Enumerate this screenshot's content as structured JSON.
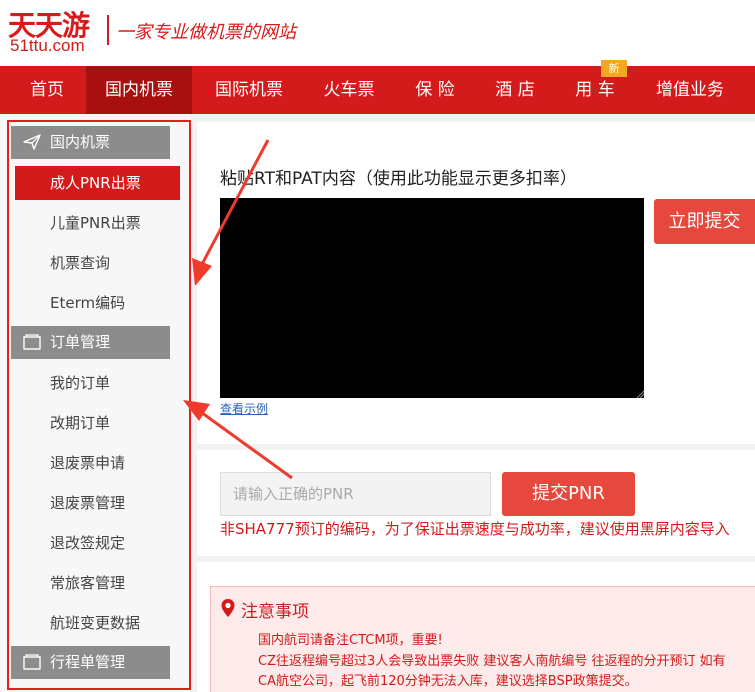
{
  "brand": {
    "name_cn": "天天游",
    "name_en": "51ttu.com",
    "slogan": "一家专业做机票的网站",
    "color": "#d71b1b"
  },
  "nav": {
    "items": [
      {
        "label": "首页"
      },
      {
        "label": "国内机票",
        "active": true
      },
      {
        "label": "国际机票"
      },
      {
        "label": "火车票"
      },
      {
        "label": "保 险"
      },
      {
        "label": "酒 店"
      },
      {
        "label": "用 车",
        "badge": "新"
      },
      {
        "label": "增值业务"
      }
    ],
    "bg_color": "#d41b1b"
  },
  "sidebar": {
    "section_domestic": {
      "title": "国内机票",
      "icon": "paper-plane-icon"
    },
    "items_domestic": [
      "成人PNR出票",
      "儿童PNR出票",
      "机票查询",
      "Eterm编码"
    ],
    "section_orders": {
      "title": "订单管理",
      "icon": "folder-icon"
    },
    "items_orders": [
      "我的订单",
      "改期订单",
      "退废票申请",
      "退废票管理",
      "退改签规定",
      "常旅客管理",
      "航班变更数据"
    ],
    "section_itinerary": {
      "title": "行程单管理",
      "icon": "folder-icon"
    }
  },
  "paste": {
    "title": "粘贴RT和PAT内容（使用此功能显示更多扣率）",
    "submit_label": "立即提交",
    "example_link": "查看示例"
  },
  "pnr": {
    "placeholder": "请输入正确的PNR",
    "submit_label": "提交PNR",
    "note": "非SHA777预订的编码，为了保证出票速度与成功率，建议使用黑屏内容导入"
  },
  "notice": {
    "title": "注意事项",
    "lines": [
      "国内航司请备注CTCM项，重要!",
      "CZ往返程编号超过3人会导致出票失败 建议客人南航编号 往返程的分开预订 如有",
      "CA航空公司，起飞前120分钟无法入库，建议选择BSP政策提交。"
    ]
  }
}
